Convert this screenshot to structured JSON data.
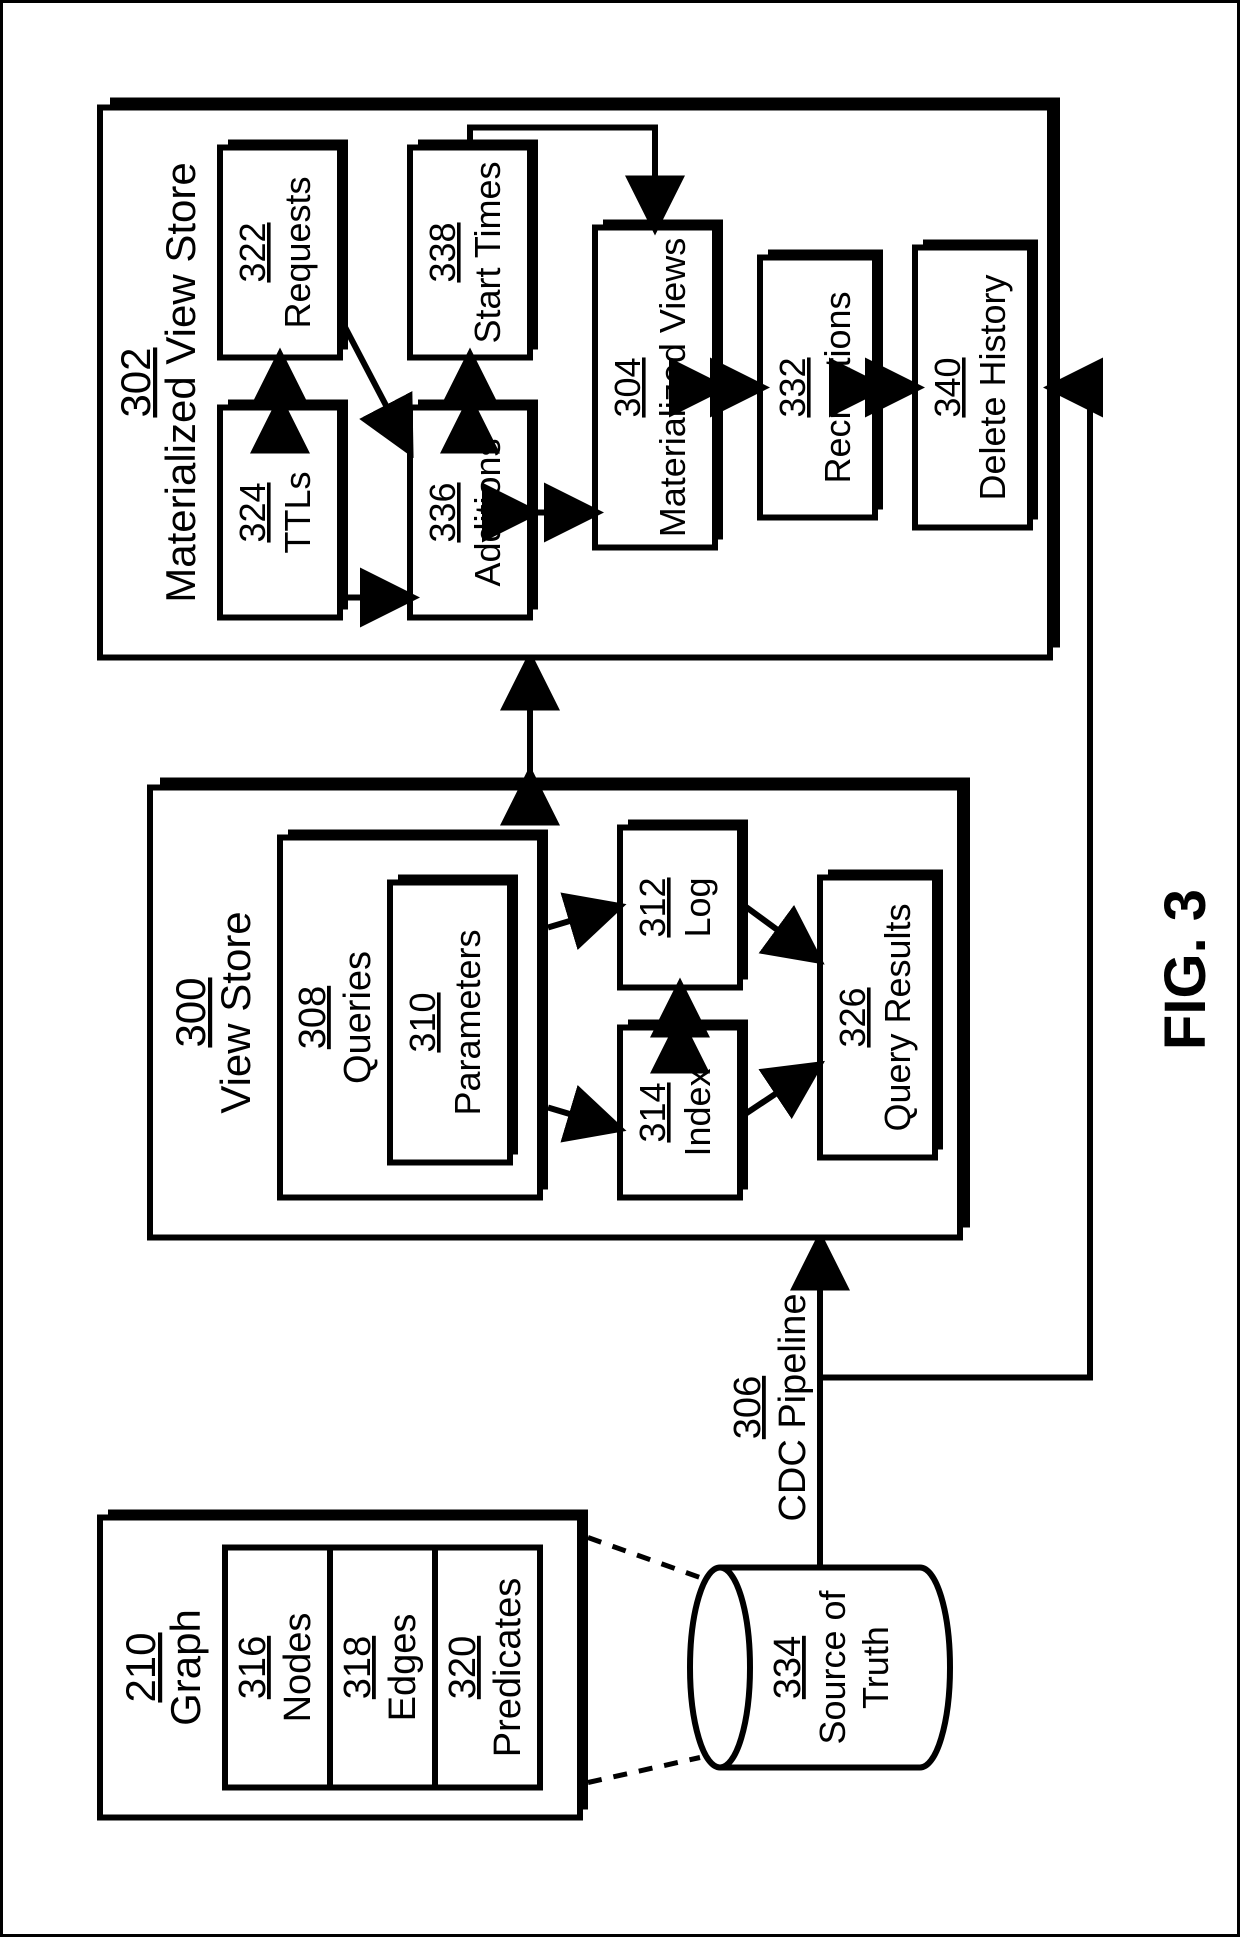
{
  "figure_label": "FIG. 3",
  "graph": {
    "ref": "210",
    "title": "Graph",
    "nodes": {
      "ref": "316",
      "label": "Nodes"
    },
    "edges": {
      "ref": "318",
      "label": "Edges"
    },
    "predicates": {
      "ref": "320",
      "label": "Predicates"
    }
  },
  "source_of_truth": {
    "ref": "334",
    "label": "Source of\nTruth"
  },
  "cdc_pipeline": {
    "ref": "306",
    "label": "CDC Pipeline"
  },
  "view_store": {
    "ref": "300",
    "title": "View Store",
    "queries": {
      "ref": "308",
      "label": "Queries",
      "parameters": {
        "ref": "310",
        "label": "Parameters"
      }
    },
    "index": {
      "ref": "314",
      "label": "Index"
    },
    "log": {
      "ref": "312",
      "label": "Log"
    },
    "query_results": {
      "ref": "326",
      "label": "Query Results"
    }
  },
  "mv_store": {
    "ref": "302",
    "title": "Materialized View Store",
    "ttls": {
      "ref": "324",
      "label": "TTLs"
    },
    "requests": {
      "ref": "322",
      "label": "Requests"
    },
    "additions": {
      "ref": "336",
      "label": "Additions"
    },
    "start_times": {
      "ref": "338",
      "label": "Start Times"
    },
    "materialized_views": {
      "ref": "304",
      "label": "Materialized Views"
    },
    "recreations": {
      "ref": "332",
      "label": "Recreations"
    },
    "delete_history": {
      "ref": "340",
      "label": "Delete History"
    }
  }
}
